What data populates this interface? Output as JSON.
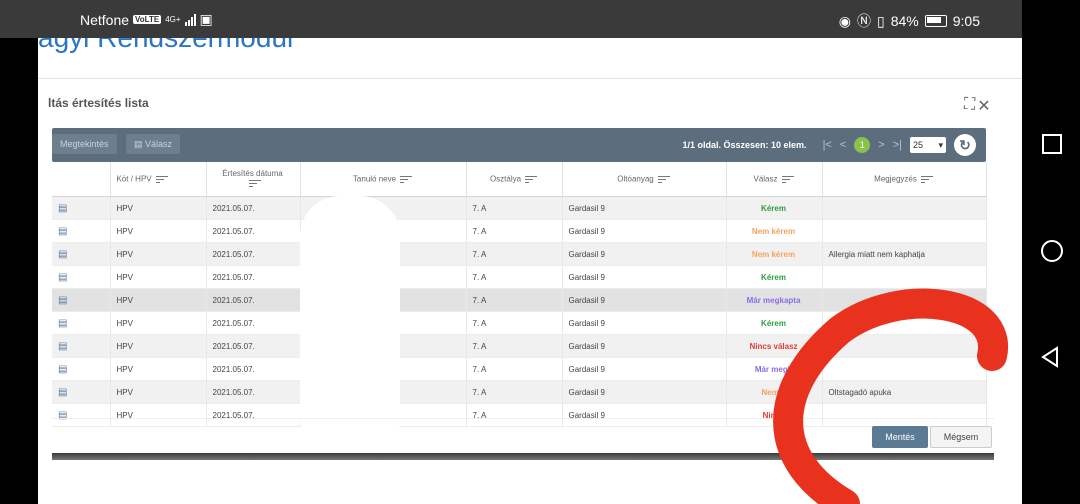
{
  "status": {
    "carrier": "Netfone",
    "volte": "VoLTE",
    "network": "4G+",
    "battery": "84%",
    "time": "9:05"
  },
  "app": {
    "title_fragment": "agyi Rendszermodul"
  },
  "dialog": {
    "title": "ltás értesítés lista",
    "icons": [
      "expand-icon",
      "close-icon"
    ]
  },
  "toolbar": {
    "buttons": [
      "Megtekintés",
      "Válasz"
    ],
    "pager_text": "1/1 oldal. Összesen: 10 elem.",
    "current_page": "1",
    "page_size": "25"
  },
  "columns": [
    "",
    "Köt / HPV",
    "Értesítés dátuma",
    "Tanuló neve",
    "Osztálya",
    "Oltóanyag",
    "Válasz",
    "Megjegyzés"
  ],
  "rows": [
    {
      "type": "HPV",
      "date": "2021.05.07.",
      "class": "7. A",
      "vaccine": "Gardasil 9",
      "answer": "Kérem",
      "answer_color": "#2e9d3a",
      "note": ""
    },
    {
      "type": "HPV",
      "date": "2021.05.07.",
      "class": "7. A",
      "vaccine": "Gardasil 9",
      "answer": "Nem kérem",
      "answer_color": "#f5a25d",
      "note": ""
    },
    {
      "type": "HPV",
      "date": "2021.05.07.",
      "class": "7. A",
      "vaccine": "Gardasil 9",
      "answer": "Nem kérem",
      "answer_color": "#f5a25d",
      "note": "Allergia miatt nem kaphatja"
    },
    {
      "type": "HPV",
      "date": "2021.05.07.",
      "class": "7. A",
      "vaccine": "Gardasil 9",
      "answer": "Kérem",
      "answer_color": "#2e9d3a",
      "note": ""
    },
    {
      "type": "HPV",
      "date": "2021.05.07.",
      "class": "7. A",
      "vaccine": "Gardasil 9",
      "answer": "Már megkapta",
      "answer_color": "#8a6de6",
      "note": ""
    },
    {
      "type": "HPV",
      "date": "2021.05.07.",
      "class": "7. A",
      "vaccine": "Gardasil 9",
      "answer": "Kérem",
      "answer_color": "#2e9d3a",
      "note": ""
    },
    {
      "type": "HPV",
      "date": "2021.05.07.",
      "class": "7. A",
      "vaccine": "Gardasil 9",
      "answer": "Nincs válasz",
      "answer_color": "#e53935",
      "note": ""
    },
    {
      "type": "HPV",
      "date": "2021.05.07.",
      "class": "7. A",
      "vaccine": "Gardasil 9",
      "answer": "Már megk",
      "answer_color": "#8a6de6",
      "note": ""
    },
    {
      "type": "HPV",
      "date": "2021.05.07.",
      "class": "7. A",
      "vaccine": "Gardasil 9",
      "answer": "Nem k",
      "answer_color": "#f5a25d",
      "note": "Oltstagadó apuka"
    },
    {
      "type": "HPV",
      "date": "2021.05.07.",
      "class": "7. A",
      "vaccine": "Gardasil 9",
      "answer": "Nincs",
      "answer_color": "#e53935",
      "note": ""
    }
  ],
  "footer": {
    "save": "Mentés",
    "cancel": "Mégsem"
  },
  "colors": {
    "annotation": "#e8321e",
    "toolbar": "#5c6e7d",
    "title": "#2a75c4"
  }
}
